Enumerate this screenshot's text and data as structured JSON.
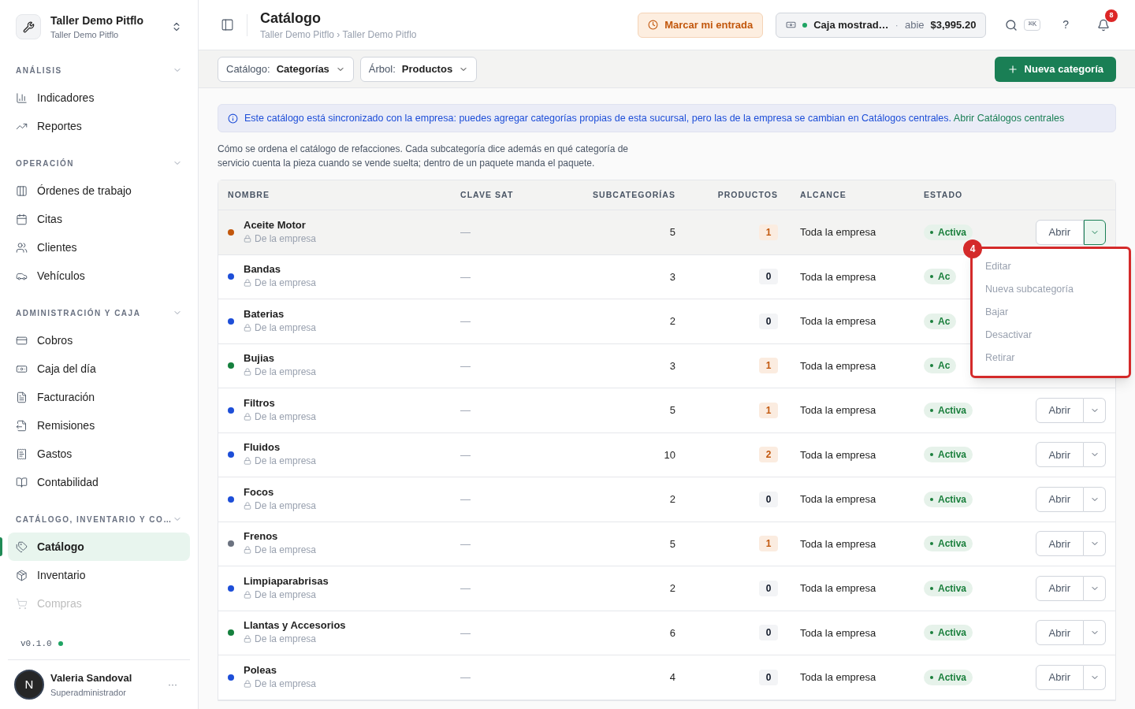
{
  "workspace": {
    "name": "Taller Demo Pitflo",
    "subtitle": "Taller Demo Pitflo"
  },
  "sidebar": {
    "sections": [
      {
        "title": "ANÁLISIS",
        "expanded": true,
        "items": [
          {
            "label": "Indicadores",
            "selected": false,
            "faded": false
          },
          {
            "label": "Reportes",
            "selected": false,
            "faded": false
          }
        ]
      },
      {
        "title": "OPERACIÓN",
        "expanded": true,
        "items": [
          {
            "label": "Órdenes de trabajo",
            "selected": false,
            "faded": false
          },
          {
            "label": "Citas",
            "selected": false,
            "faded": false
          },
          {
            "label": "Clientes",
            "selected": false,
            "faded": false
          },
          {
            "label": "Vehículos",
            "selected": false,
            "faded": false
          }
        ]
      },
      {
        "title": "ADMINISTRACIÓN Y CAJA",
        "expanded": true,
        "items": [
          {
            "label": "Cobros",
            "selected": false,
            "faded": false
          },
          {
            "label": "Caja del día",
            "selected": false,
            "faded": false
          },
          {
            "label": "Facturación",
            "selected": false,
            "faded": false
          },
          {
            "label": "Remisiones",
            "selected": false,
            "faded": false
          },
          {
            "label": "Gastos",
            "selected": false,
            "faded": false
          },
          {
            "label": "Contabilidad",
            "selected": false,
            "faded": false
          }
        ]
      },
      {
        "title": "CATÁLOGO, INVENTARIO Y CO…",
        "expanded": true,
        "items": [
          {
            "label": "Catálogo",
            "selected": true,
            "faded": false
          },
          {
            "label": "Inventario",
            "selected": false,
            "faded": false
          },
          {
            "label": "Compras",
            "selected": false,
            "faded": true
          }
        ]
      }
    ],
    "version": "v0.1.0",
    "user": {
      "initial": "N",
      "name": "Valeria Sandoval",
      "role": "Superadministrador",
      "menu": "···"
    }
  },
  "header": {
    "title": "Catálogo",
    "breadcrumb": "Taller Demo Pitflo › Taller Demo Pitflo",
    "clock_in": "Marcar mi entrada",
    "register": {
      "name": "Caja mostrad…",
      "separator": "·",
      "state": "abie",
      "amount": "$3,995.20"
    },
    "shortcut": "⌘K",
    "help": "?",
    "notifications": "8"
  },
  "toolbar": {
    "filters": [
      {
        "label": "Catálogo:",
        "value": "Categorías"
      },
      {
        "label": "Árbol:",
        "value": "Productos"
      }
    ],
    "new_button": "Nueva categoría"
  },
  "notice": {
    "text": "Este catálogo está sincronizado con la empresa: puedes agregar categorías propias de esta sucursal, pero las de la empresa se cambian en Catálogos centrales.",
    "link": "Abrir Catálogos centrales"
  },
  "description": "Cómo se ordena el catálogo de refacciones. Cada subcategoría dice además en qué categoría de servicio cuenta la pieza cuando se vende suelta; dentro de un paquete manda el paquete.",
  "table": {
    "columns": [
      "NOMBRE",
      "CLAVE SAT",
      "SUBCATEGORÍAS",
      "PRODUCTOS",
      "ALCANCE",
      "ESTADO"
    ],
    "rows": [
      {
        "name": "Aceite Motor",
        "color": "#c2570c",
        "origin": "De la empresa",
        "sat": "—",
        "subcategories": "5",
        "products": "1",
        "highlighted": true,
        "scope": "Toda la empresa",
        "status": "Activa",
        "open_button": "Abrir",
        "selected": true
      },
      {
        "name": "Bandas",
        "color": "#1d4ed8",
        "origin": "De la empresa",
        "sat": "—",
        "subcategories": "3",
        "products": "0",
        "highlighted": false,
        "scope": "Toda la empresa",
        "status": "Ac",
        "selected": false
      },
      {
        "name": "Baterias",
        "color": "#1d4ed8",
        "origin": "De la empresa",
        "sat": "—",
        "subcategories": "2",
        "products": "0",
        "highlighted": false,
        "scope": "Toda la empresa",
        "status": "Ac",
        "selected": false
      },
      {
        "name": "Bujias",
        "color": "#15803d",
        "origin": "De la empresa",
        "sat": "—",
        "subcategories": "3",
        "products": "1",
        "highlighted": true,
        "scope": "Toda la empresa",
        "status": "Ac",
        "selected": false
      },
      {
        "name": "Filtros",
        "color": "#1d4ed8",
        "origin": "De la empresa",
        "sat": "—",
        "subcategories": "5",
        "products": "1",
        "highlighted": true,
        "scope": "Toda la empresa",
        "status": "Activa",
        "open_button": "Abrir",
        "selected": false
      },
      {
        "name": "Fluidos",
        "color": "#1d4ed8",
        "origin": "De la empresa",
        "sat": "—",
        "subcategories": "10",
        "products": "2",
        "highlighted": true,
        "scope": "Toda la empresa",
        "status": "Activa",
        "open_button": "Abrir",
        "selected": false
      },
      {
        "name": "Focos",
        "color": "#1d4ed8",
        "origin": "De la empresa",
        "sat": "—",
        "subcategories": "2",
        "products": "0",
        "highlighted": false,
        "scope": "Toda la empresa",
        "status": "Activa",
        "open_button": "Abrir",
        "selected": false
      },
      {
        "name": "Frenos",
        "color": "#6b7280",
        "origin": "De la empresa",
        "sat": "—",
        "subcategories": "5",
        "products": "1",
        "highlighted": true,
        "scope": "Toda la empresa",
        "status": "Activa",
        "open_button": "Abrir",
        "selected": false
      },
      {
        "name": "Limpiaparabrisas",
        "color": "#1d4ed8",
        "origin": "De la empresa",
        "sat": "—",
        "subcategories": "2",
        "products": "0",
        "highlighted": false,
        "scope": "Toda la empresa",
        "status": "Activa",
        "open_button": "Abrir",
        "selected": false
      },
      {
        "name": "Llantas y Accesorios",
        "color": "#15803d",
        "origin": "De la empresa",
        "sat": "—",
        "subcategories": "6",
        "products": "0",
        "highlighted": false,
        "scope": "Toda la empresa",
        "status": "Activa",
        "open_button": "Abrir",
        "selected": false
      },
      {
        "name": "Poleas",
        "color": "#1d4ed8",
        "origin": "De la empresa",
        "sat": "—",
        "subcategories": "4",
        "products": "0",
        "highlighted": false,
        "scope": "Toda la empresa",
        "status": "Activa",
        "open_button": "Abrir",
        "selected": false
      }
    ]
  },
  "row_menu": {
    "marker": "4",
    "items": [
      {
        "label": "Editar",
        "disabled": true
      },
      {
        "label": "Nueva subcategoría",
        "disabled": true
      },
      {
        "label": "Bajar",
        "disabled": true
      },
      {
        "label": "Desactivar",
        "disabled": true
      },
      {
        "label": "Retirar",
        "disabled": true
      }
    ]
  }
}
